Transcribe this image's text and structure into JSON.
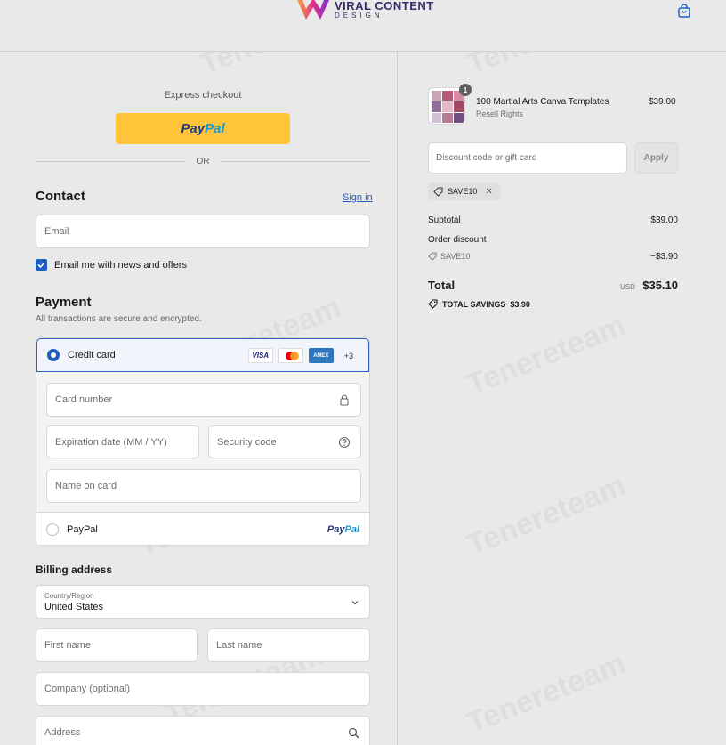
{
  "header": {
    "brand_title": "VIRAL CONTENT",
    "brand_sub": "DESIGN",
    "cart_icon": "shopping-bag-icon"
  },
  "express": {
    "label": "Express checkout",
    "paypal_dark": "Pay",
    "paypal_light": "Pal",
    "or": "OR"
  },
  "contact": {
    "heading": "Contact",
    "signin": "Sign in",
    "email_placeholder": "Email",
    "newsletter_label": "Email me with news and offers",
    "newsletter_checked": true
  },
  "payment": {
    "heading": "Payment",
    "subtitle": "All transactions are secure and encrypted.",
    "credit_card_label": "Credit card",
    "card_brands": [
      "VISA",
      "AMEX"
    ],
    "more_brands": "+3",
    "card_number": "Card number",
    "expiration": "Expiration date (MM / YY)",
    "security_code": "Security code",
    "name_on_card": "Name on card",
    "paypal_label": "PayPal",
    "paypal_logo_dark": "Pay",
    "paypal_logo_light": "Pal"
  },
  "billing": {
    "heading": "Billing address",
    "country_label": "Country/Region",
    "country_value": "United States",
    "first_name": "First name",
    "last_name": "Last name",
    "company": "Company (optional)",
    "address": "Address"
  },
  "order": {
    "qty": "1",
    "product_name": "100 Martial Arts Canva Templates",
    "product_variant": "Resell Rights",
    "product_price": "$39.00",
    "discount_placeholder": "Discount code or gift card",
    "apply": "Apply",
    "applied_code": "SAVE10",
    "subtotal_label": "Subtotal",
    "subtotal_value": "$39.00",
    "order_discount_label": "Order discount",
    "discount_code": "SAVE10",
    "discount_value": "−$3.90",
    "total_label": "Total",
    "currency": "USD",
    "total_value": "$35.10",
    "savings_label": "TOTAL SAVINGS",
    "savings_value": "$3.90"
  },
  "colors": {
    "accent": "#1f5fbf",
    "paypal_yellow": "#ffc439",
    "background": "#e9e9e9"
  }
}
